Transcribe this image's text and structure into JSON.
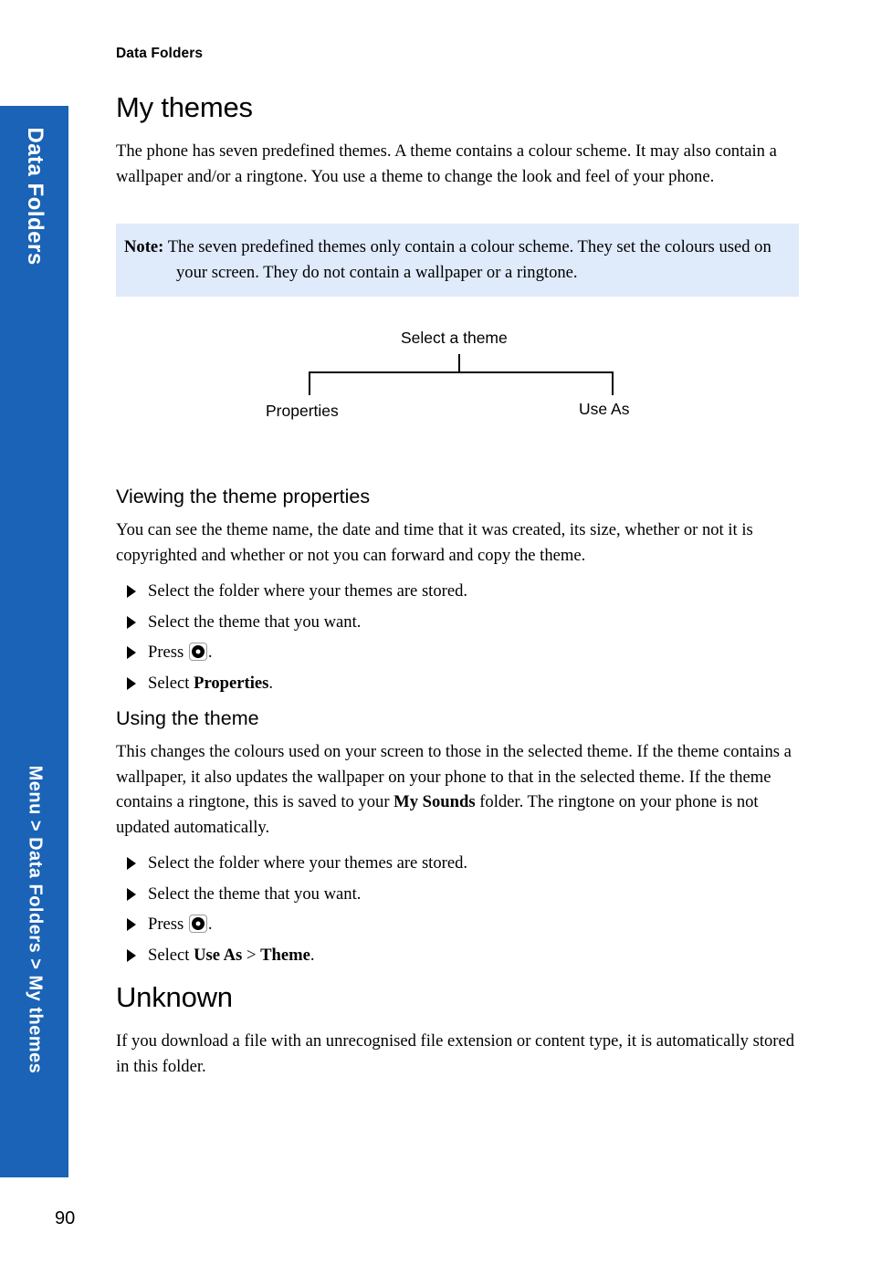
{
  "page": {
    "running_head": "Data Folders",
    "folio": "90",
    "accent_blue": "#1a63b6",
    "note_bg": "#dfeafb"
  },
  "side_tab": {
    "top_label": "Data Folders",
    "bottom_label": "Menu > Data Folders > My themes"
  },
  "title": "My themes",
  "intro": "The phone has seven predefined themes. A theme contains a colour scheme. It may also contain a wallpaper and/or a ringtone. You use a theme to change the look and feel of your phone.",
  "note": {
    "label": "Note:",
    "text": "The seven predefined themes only contain a colour scheme. They set the colours used on your screen. They do not contain a wallpaper or a ringtone."
  },
  "diagram": {
    "root": "Select a theme",
    "left": "Properties",
    "right": "Use As"
  },
  "sections": [
    {
      "heading": "Viewing the theme properties",
      "body": "You can see the theme name, the date and time that it was created, its size, whether or not it is copyrighted and whether or not you can forward and copy the theme.",
      "steps": [
        {
          "pre": "Select the folder where your themes are stored.",
          "icon": "",
          "post": ""
        },
        {
          "pre": "Select the theme that you want.",
          "icon": "",
          "post": ""
        },
        {
          "pre": "Press ",
          "icon": "select-key-icon",
          "post": "."
        },
        {
          "pre": "Select ",
          "icon": "",
          "bold": "Properties",
          "post": "."
        }
      ]
    },
    {
      "heading": "Using the theme",
      "body_parts": {
        "a": "This changes the colours used on your screen to those in the selected theme. If the theme contains a wallpaper, it also updates the wallpaper on your phone to that in the selected theme. If the theme contains a ringtone, this is saved to your ",
        "bold": "My Sounds",
        "b": " folder. The ringtone on your phone is not updated automatically."
      },
      "steps": [
        {
          "pre": "Select the folder where your themes are stored.",
          "icon": "",
          "post": ""
        },
        {
          "pre": "Select the theme that you want.",
          "icon": "",
          "post": ""
        },
        {
          "pre": "Press ",
          "icon": "select-key-icon",
          "post": "."
        },
        {
          "pre": "Select ",
          "bold": "Use As",
          "mid": " > ",
          "bold2": "Theme",
          "post": "."
        }
      ]
    },
    {
      "heading": "Unknown",
      "body": "If you download a file with an unrecognised file extension or content type, it is automatically stored in this folder."
    }
  ]
}
